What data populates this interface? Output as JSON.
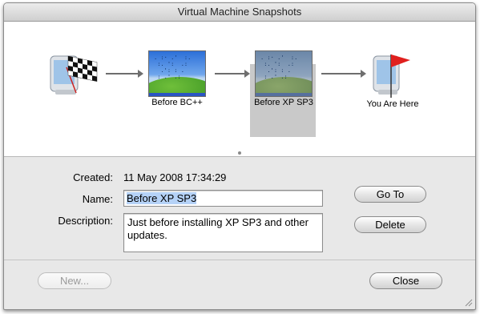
{
  "window": {
    "title": "Virtual Machine Snapshots"
  },
  "snapshots": [
    {
      "label": "",
      "icon": "vm-start-monitor-icon"
    },
    {
      "label": "Before BC++",
      "icon": "windows-xp-thumbnail"
    },
    {
      "label": "Before XP SP3",
      "icon": "windows-xp-thumbnail",
      "selected": true
    },
    {
      "label": "You Are Here",
      "icon": "you-are-here-flag-icon"
    }
  ],
  "details": {
    "created_label": "Created:",
    "created_value": "11 May 2008 17:34:29",
    "name_label": "Name:",
    "name_value": "Before XP SP3",
    "description_label": "Description:",
    "description_value": "Just before installing XP SP3 and other updates."
  },
  "buttons": {
    "go_to": "Go To",
    "delete": "Delete",
    "new": "New...",
    "close": "Close"
  },
  "colors": {
    "selection_highlight": "#b5d2f7",
    "selected_node_bg": "#c9c9c9",
    "flag_red": "#e0201e"
  }
}
